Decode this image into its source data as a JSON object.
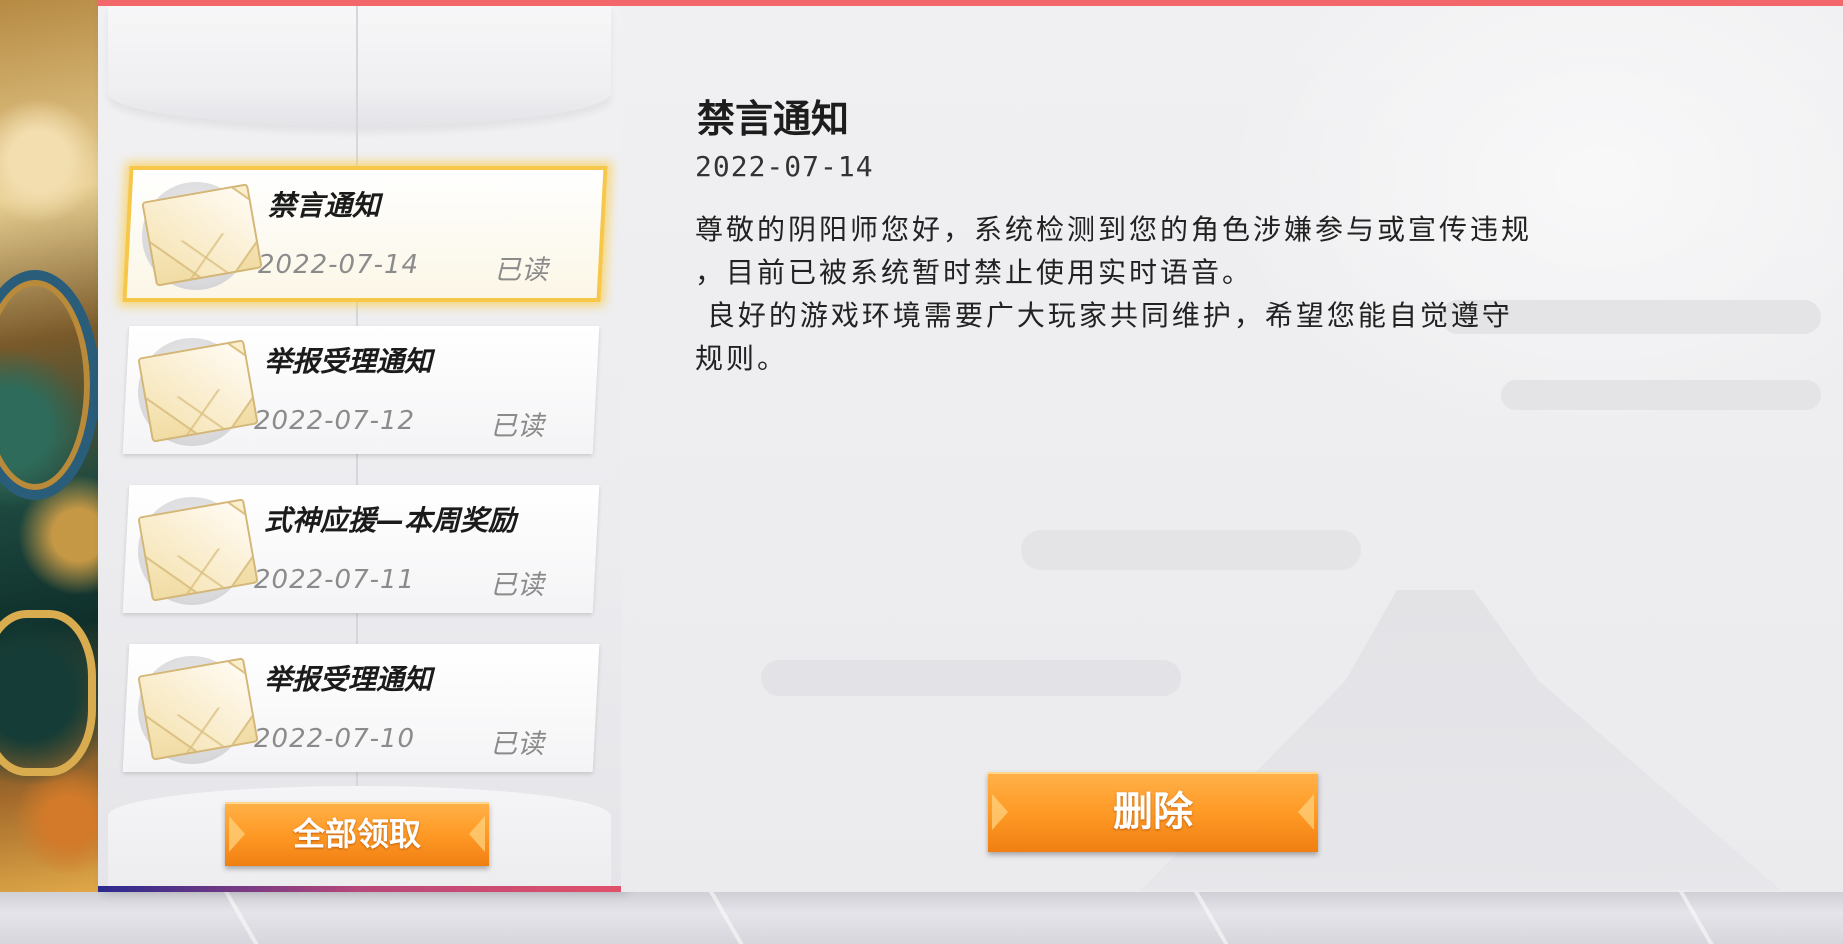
{
  "mail_list": [
    {
      "title": "禁言通知",
      "date": "2022-07-14",
      "status": "已读",
      "selected": true
    },
    {
      "title": "举报受理通知",
      "date": "2022-07-12",
      "status": "已读",
      "selected": false
    },
    {
      "title": "式神应援—本周奖励",
      "date": "2022-07-11",
      "status": "已读",
      "selected": false
    },
    {
      "title": "举报受理通知",
      "date": "2022-07-10",
      "status": "已读",
      "selected": false
    }
  ],
  "claim_all_label": "全部领取",
  "detail": {
    "title": "禁言通知",
    "date": "2022-07-14",
    "body_lines": [
      "尊敬的阴阳师您好，系统检测到您的角色涉嫌参与或宣传违规",
      "，目前已被系统暂时禁止使用实时语音。",
      " 良好的游戏环境需要广大玩家共同维护，希望您能自觉遵守",
      "规则。"
    ]
  },
  "delete_label": "删除",
  "colors": {
    "accent_top": "#f2676a",
    "button_orange": "#ff9a26",
    "selected_border": "#f7c74a"
  }
}
